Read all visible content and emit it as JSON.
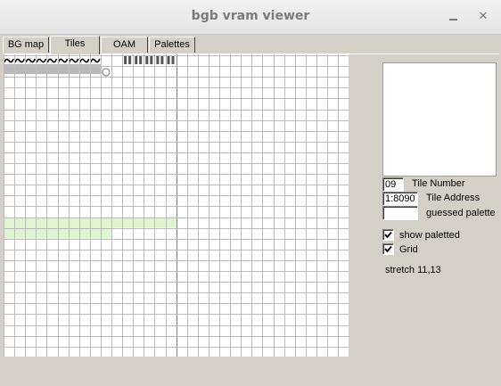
{
  "window": {
    "title": "bgb vram viewer",
    "minimize_icon": "minimize-icon",
    "close_icon": "close-icon",
    "close_glyph": "✕"
  },
  "tabs": [
    {
      "label": "BG map",
      "active": false
    },
    {
      "label": "Tiles",
      "active": true
    },
    {
      "label": "OAM",
      "active": false
    },
    {
      "label": "Palettes",
      "active": false
    }
  ],
  "tile_grid": {
    "columns": 32,
    "rows": 24,
    "highlighted_rows": [
      {
        "row": 15,
        "from_col": 0,
        "to_col": 15
      },
      {
        "row": 16,
        "from_col": 0,
        "to_col": 9
      }
    ],
    "highlight_color": "#dff5d0",
    "logo_tiles": {
      "row": 0,
      "from_col": 0,
      "to_col": 15
    }
  },
  "tile_info": {
    "tile_number": "09",
    "tile_number_label": "Tile Number",
    "tile_address": "1:8090",
    "tile_address_label": "Tile Address",
    "guessed_palette": "",
    "guessed_palette_label": "guessed palette"
  },
  "options": {
    "show_paletted": {
      "label": "show paletted",
      "checked": true
    },
    "grid": {
      "label": "Grid",
      "checked": true
    }
  },
  "stretch_text": "stretch 11,13"
}
